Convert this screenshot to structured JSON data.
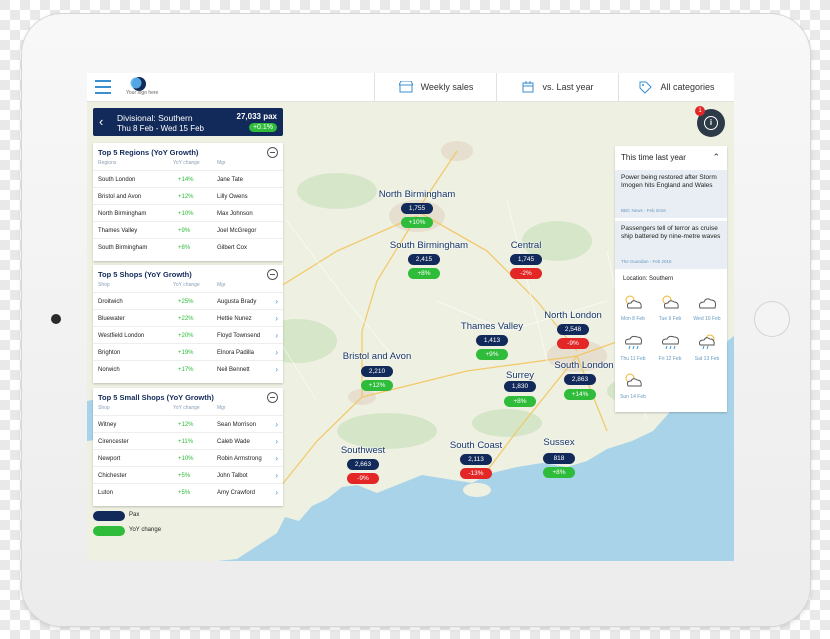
{
  "topbar": {
    "logo_text": "Your logo here",
    "tabs": [
      {
        "label": "Weekly sales",
        "icon": "store-icon"
      },
      {
        "label": "vs. Last year",
        "icon": "calendar-icon"
      },
      {
        "label": "All categories",
        "icon": "tag-icon"
      }
    ]
  },
  "header": {
    "title": "Divisional: Southern",
    "dates": "Thu 8 Feb - Wed 15 Feb",
    "pax": "27,033 pax",
    "change": "+0.1%"
  },
  "regions": {
    "title": "Top 5  Regions (YoY Growth)",
    "headers": [
      "Regions",
      "YoY change",
      "Mgr"
    ],
    "rows": [
      {
        "name": "South London",
        "change": "+14%",
        "mgr": "Jane Tate"
      },
      {
        "name": "Bristol and Avon",
        "change": "+12%",
        "mgr": "Lilly Owens"
      },
      {
        "name": "North Birmingham",
        "change": "+10%",
        "mgr": "Max Johnson"
      },
      {
        "name": "Thames Valley",
        "change": "+9%",
        "mgr": "Joel McGregor"
      },
      {
        "name": "South Birmingham",
        "change": "+8%",
        "mgr": "Gilbert Cox"
      }
    ]
  },
  "shops": {
    "title": "Top 5 Shops (YoY Growth)",
    "headers": [
      "Shop",
      "YoY change",
      "Mgr"
    ],
    "rows": [
      {
        "name": "Droitwich",
        "change": "+25%",
        "mgr": "Augusta Brady"
      },
      {
        "name": "Bluewater",
        "change": "+22%",
        "mgr": "Hettie Nunez"
      },
      {
        "name": "Westfield London",
        "change": "+20%",
        "mgr": "Floyd Townsend"
      },
      {
        "name": "Brighton",
        "change": "+19%",
        "mgr": "Elnora Padilla"
      },
      {
        "name": "Norwich",
        "change": "+17%",
        "mgr": "Neil Bennett"
      }
    ]
  },
  "small_shops": {
    "title": "Top 5 Small Shops (YoY Growth)",
    "headers": [
      "Shop",
      "YoY change",
      "Mgr"
    ],
    "rows": [
      {
        "name": "Witney",
        "change": "+12%",
        "mgr": "Sean Morrison"
      },
      {
        "name": "Cirencester",
        "change": "+11%",
        "mgr": "Caleb Wade"
      },
      {
        "name": "Newport",
        "change": "+10%",
        "mgr": "Robin Armstrong"
      },
      {
        "name": "Chichester",
        "change": "+5%",
        "mgr": "John Talbot"
      },
      {
        "name": "Luton",
        "change": "+5%",
        "mgr": "Amy Crawford"
      }
    ]
  },
  "legend": {
    "pax": "Pax",
    "yoy": "YoY change"
  },
  "map_regions": [
    {
      "name": "North Birmingham",
      "pax": "1,755",
      "change": "+10%",
      "trend": "up"
    },
    {
      "name": "South Birmingham",
      "pax": "2,415",
      "change": "+8%",
      "trend": "up"
    },
    {
      "name": "Central",
      "pax": "1,745",
      "change": "-2%",
      "trend": "down"
    },
    {
      "name": "North London",
      "pax": "2,548",
      "change": "-9%",
      "trend": "down"
    },
    {
      "name": "Thames Valley",
      "pax": "1,413",
      "change": "+9%",
      "trend": "up"
    },
    {
      "name": "Bristol and Avon",
      "pax": "2,210",
      "change": "+12%",
      "trend": "up"
    },
    {
      "name": "Surrey",
      "pax": "1,830",
      "change": "+8%",
      "trend": "up"
    },
    {
      "name": "South London",
      "pax": "2,863",
      "change": "+14%",
      "trend": "up"
    },
    {
      "name": "Southwest",
      "pax": "2,663",
      "change": "-9%",
      "trend": "down"
    },
    {
      "name": "South Coast",
      "pax": "2,113",
      "change": "-13%",
      "trend": "down"
    },
    {
      "name": "Sussex",
      "pax": "818",
      "change": "+8%",
      "trend": "up"
    }
  ],
  "info": {
    "badge": "1",
    "icon": "i"
  },
  "last_year": {
    "title": "This time last year",
    "news": [
      {
        "headline": "Power being restored after Storm Imogen hits England and Wales",
        "source": "BBC News - Feb 2016"
      },
      {
        "headline": "Passengers tell of terror as cruise ship battered by nine-metre waves",
        "source": "The Guardian - Feb 2016"
      }
    ],
    "location": "Location: Southern",
    "weather": [
      {
        "day": "Mon 8 Feb",
        "icon": "sun-cloud-icon"
      },
      {
        "day": "Tue 9 Feb",
        "icon": "sun-cloud-icon"
      },
      {
        "day": "Wed 10 Feb",
        "icon": "cloud-icon"
      },
      {
        "day": "Thu 11 Feb",
        "icon": "rain-icon"
      },
      {
        "day": "Fri 12 Feb",
        "icon": "rain-icon"
      },
      {
        "day": "Sat 13 Feb",
        "icon": "sun-rain-icon"
      },
      {
        "day": "Sun 14 Feb",
        "icon": "sun-cloud-icon"
      }
    ]
  },
  "colors": {
    "navy": "#122a5a",
    "green": "#2ebc3a",
    "red": "#e32626",
    "sea": "#a9d3e8",
    "land": "#eef0e2",
    "accent": "#3a8fd0"
  }
}
